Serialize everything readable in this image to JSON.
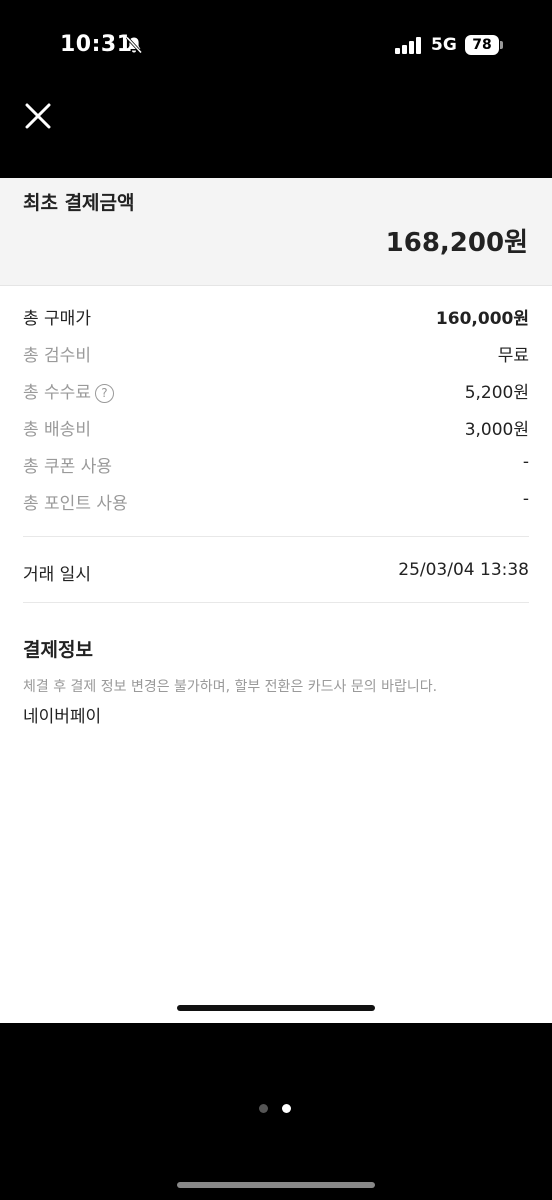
{
  "status_bar": {
    "time": "10:31",
    "network": "5G",
    "battery": "78",
    "icons": [
      "bell-slash-icon",
      "signal-bars-icon"
    ]
  },
  "nav": {
    "close_icon": "close-icon"
  },
  "summary": {
    "title": "최초 결제금액",
    "amount": "168,200원"
  },
  "fees": [
    {
      "label": "총 구매가",
      "value": "160,000원",
      "primary": true
    },
    {
      "label": "총 검수비",
      "value": "무료"
    },
    {
      "label": "총 수수료",
      "value": "5,200원",
      "help": "?"
    },
    {
      "label": "총 배송비",
      "value": "3,000원"
    },
    {
      "label": "총 쿠폰 사용",
      "value": "-"
    },
    {
      "label": "총 포인트 사용",
      "value": "-"
    }
  ],
  "trade": {
    "label": "거래 일시",
    "value": "25/03/04 13:38"
  },
  "payment": {
    "title": "결제정보",
    "notice": "체결 후 결제 정보 변경은 불가하며, 할부 전환은 카드사 문의 바랍니다.",
    "method": "네이버페이"
  },
  "pager": {
    "current_page": 2,
    "total_pages": 2
  }
}
